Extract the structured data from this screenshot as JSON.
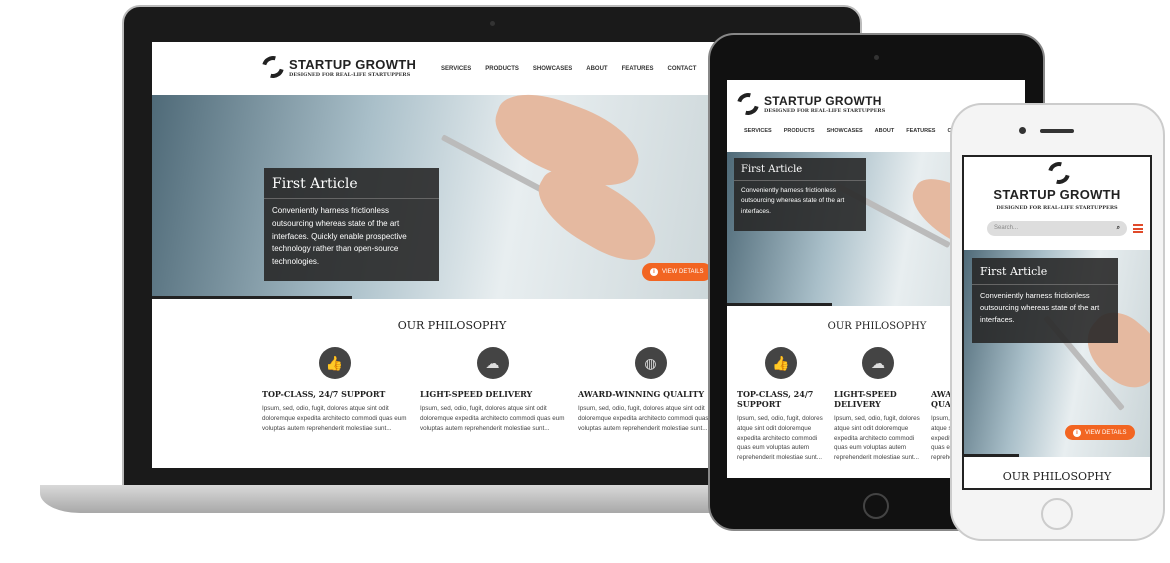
{
  "site": {
    "brand": "STARTUP GROWTH",
    "tagline": "DESIGNED FOR REAL-LIFE STARTUPPERS",
    "nav": [
      "SERVICES",
      "PRODUCTS",
      "SHOWCASES",
      "ABOUT",
      "FEATURES",
      "CONTACT"
    ],
    "search_placeholder": "Search...",
    "article": {
      "title": "First Article",
      "body_full": "Conveniently harness frictionless outsourcing whereas state of the art interfaces. Quickly enable prospective technology rather than open-source technologies.",
      "body_short": "Conveniently harness frictionless outsourcing whereas state of the art interfaces.",
      "button": "VIEW DETAILS"
    },
    "philosophy_heading": "OUR PHILOSOPHY",
    "features": [
      {
        "title": "TOP-CLASS, 24/7 SUPPORT",
        "icon": "thumbs-up-icon",
        "text": "Ipsum, sed, odio, fugit, dolores atque sint odit doloremque expedita architecto commodi quas eum voluptas autem reprehenderit molestiae sunt..."
      },
      {
        "title": "LIGHT-SPEED DELIVERY",
        "icon": "cloud-download-icon",
        "text": "Ipsum, sed, odio, fugit, dolores atque sint odit doloremque expedita architecto commodi quas eum voluptas autem reprehenderit molestiae sunt..."
      },
      {
        "title": "AWARD-WINNING QUALITY",
        "icon": "globe-icon",
        "text": "Ipsum, sed, odio, fugit, dolores atque sint odit doloremque expedita architecto commodi quas eum voluptas autem reprehenderit molestiae sunt..."
      }
    ]
  },
  "colors": {
    "accent": "#f26522",
    "dark": "#333333"
  }
}
